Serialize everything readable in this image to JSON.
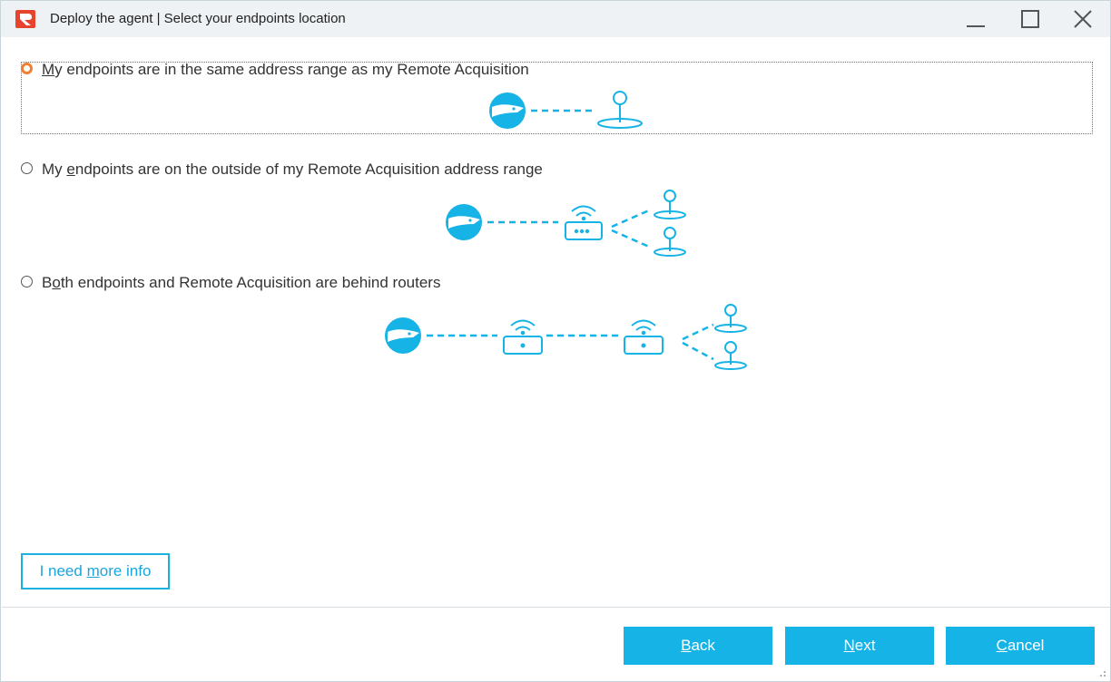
{
  "window": {
    "title": "Deploy the agent | Select your endpoints location",
    "icons": {
      "app": "app-logo-icon",
      "minimize": "minimize-icon",
      "maximize": "maximize-icon",
      "close": "close-icon"
    }
  },
  "options": [
    {
      "label_pre": "",
      "label_accel": "M",
      "label_post": "y endpoints are in the same address range as my Remote Acquisition",
      "selected": true,
      "diagram": "agent-to-endpoint"
    },
    {
      "label_pre": "My ",
      "label_accel": "e",
      "label_post": "ndpoints are on the outside of my Remote Acquisition address range",
      "selected": false,
      "diagram": "agent-router-endpoints"
    },
    {
      "label_pre": "B",
      "label_accel": "o",
      "label_post": "th endpoints and Remote Acquisition are behind routers",
      "selected": false,
      "diagram": "agent-router-router-endpoints"
    }
  ],
  "info_button": {
    "pre": "I need ",
    "accel": "m",
    "post": "ore info"
  },
  "footer": {
    "back": {
      "pre": "",
      "accel": "B",
      "post": "ack"
    },
    "next": {
      "pre": "",
      "accel": "N",
      "post": "ext"
    },
    "cancel": {
      "pre": "",
      "accel": "C",
      "post": "ancel"
    }
  },
  "colors": {
    "accent": "#16b3e6",
    "selected_radio": "#f27e2f",
    "titlebar": "#eef2f5"
  }
}
